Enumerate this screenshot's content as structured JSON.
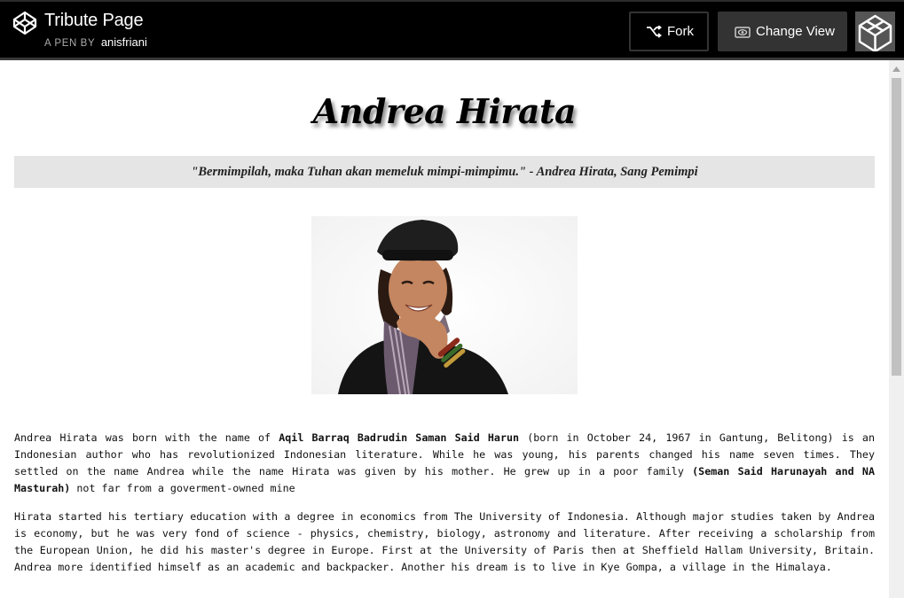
{
  "header": {
    "title": "Tribute Page",
    "byline_prefix": "A PEN BY",
    "author": "anisfriani",
    "fork_label": "Fork",
    "change_view_label": "Change View"
  },
  "page": {
    "name": "Andrea Hirata",
    "quote": "\"Bermimpilah, maka Tuhan akan memeluk mimpi-mimpimu.\" - Andrea Hirata, Sang Pemimpi",
    "bio1": {
      "part1": "Andrea Hirata was born with the name of ",
      "bold1": "Aqil Barraq Badrudin Saman Said Harun",
      "part2": " (born in October 24, 1967 in Gantung, Belitong) is an Indonesian author who has revolutionized Indonesian literature. While he was young, his parents changed his name seven times. They settled on the name Andrea while the name Hirata was given by his mother. He grew up in a poor family ",
      "bold2": "(Seman Said Harunayah and NA Masturah)",
      "part3": " not far from a goverment-owned mine"
    },
    "bio2": "Hirata started his tertiary education with a degree in economics from The University of Indonesia. Although major studies taken by Andrea is economy, but he was very fond of science - physics, chemistry, biology, astronomy and literature. After receiving a scholarship from the European Union, he did his master's degree in Europe. First at the University of Paris then at Sheffield Hallam University, Britain. Andrea more identified himself as an academic and backpacker. Another his dream is to live in Kye Gompa, a village in the Himalaya."
  },
  "icons": {
    "logo": "codepen-logo-icon",
    "fork": "fork-icon",
    "change_view": "eye-icon"
  },
  "colors": {
    "header_bg": "#000000",
    "button_bg": "#333333",
    "quote_bg": "#e5e5e5"
  }
}
